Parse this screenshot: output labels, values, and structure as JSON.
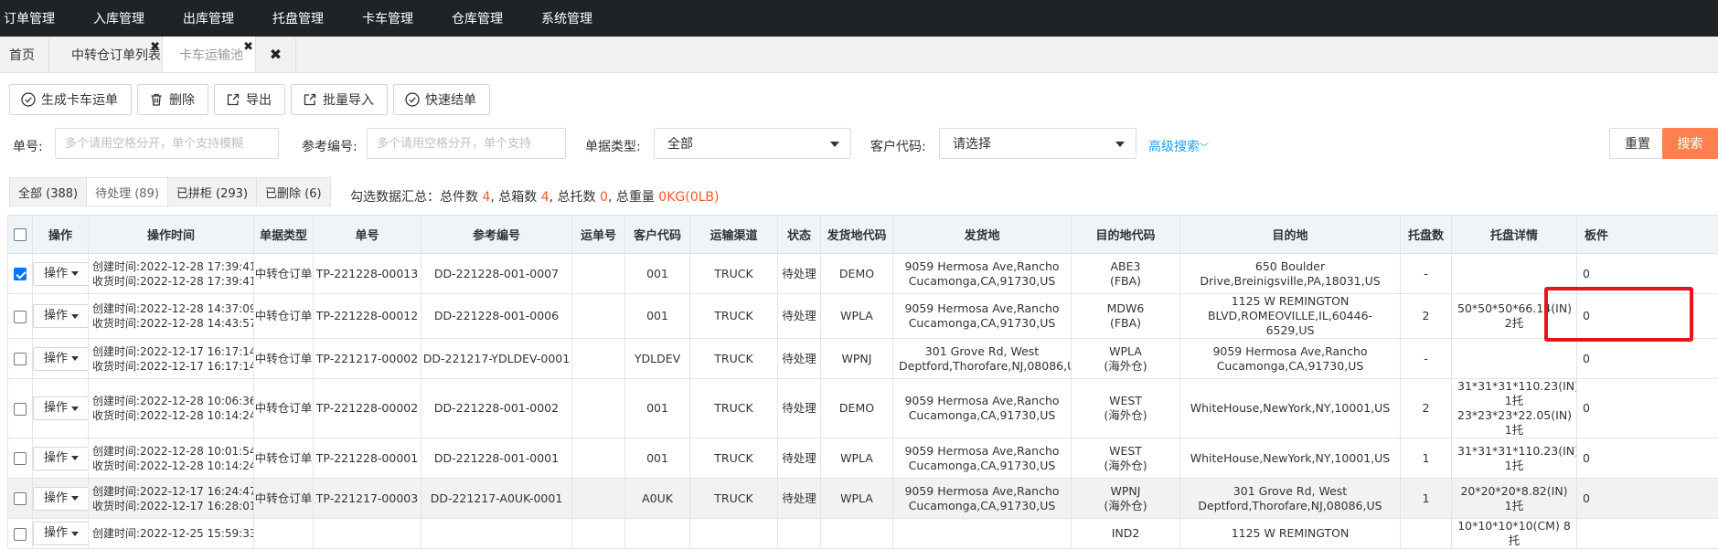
{
  "nav": [
    "订单管理",
    "入库管理",
    "出库管理",
    "托盘管理",
    "卡车管理",
    "仓库管理",
    "系统管理"
  ],
  "tabs": {
    "home": "首页",
    "t1": "中转仓订单列表",
    "t2": "卡车运输池"
  },
  "toolbar": {
    "generate": "生成卡车运单",
    "delete": "删除",
    "export": "导出",
    "import": "批量导入",
    "quick": "快速结单"
  },
  "filters": {
    "order_no_label": "单号:",
    "order_no_placeholder": "多个请用空格分开，单个支持模糊",
    "ref_label": "参考编号:",
    "ref_placeholder": "多个请用空格分开，单个支持",
    "type_label": "单据类型:",
    "type_value": "全部",
    "customer_label": "客户代码:",
    "customer_value": "请选择",
    "advanced": "高级搜索",
    "reset": "重置",
    "search": "搜索"
  },
  "status_tabs": [
    "全部 (388)",
    "待处理 (89)",
    "已拼柜 (293)",
    "已删除 (6)"
  ],
  "summary": {
    "prefix": "勾选数据汇总：总件数 ",
    "pieces": "4",
    "boxes_label": ", 总箱数 ",
    "boxes": "4",
    "pallets_label": ", 总托数 ",
    "pallets": "0",
    "weight_label": ", 总重量 ",
    "weight": "0KG(0LB)"
  },
  "columns": [
    "操作",
    "操作时间",
    "单据类型",
    "单号",
    "参考编号",
    "运单号",
    "客户代码",
    "运输渠道",
    "状态",
    "发货地代码",
    "发货地",
    "目的地代码",
    "目的地",
    "托盘数",
    "托盘详情",
    "板件"
  ],
  "op_label": "操作",
  "rows": [
    {
      "checked": true,
      "created": "创建时间:2022-12-28 17:39:41",
      "received": "收货时间:2022-12-28 17:39:41",
      "type": "中转仓订单",
      "no": "TP-221228-00013",
      "ref": "DD-221228-001-0007",
      "waybill": "",
      "customer": "001",
      "channel": "TRUCK",
      "status": "待处理",
      "from_code": "DEMO",
      "from": "9059 Hermosa Ave,Rancho Cucamonga,CA,91730,US",
      "to_code": "ABE3",
      "to_code2": "(FBA)",
      "to": "650 Boulder Drive,Breinigsville,PA,18031,US",
      "pallets": "-",
      "detail": "",
      "extra": "0"
    },
    {
      "checked": false,
      "created": "创建时间:2022-12-28 14:37:09",
      "received": "收货时间:2022-12-28 14:43:57",
      "type": "中转仓订单",
      "no": "TP-221228-00012",
      "ref": "DD-221228-001-0006",
      "waybill": "",
      "customer": "001",
      "channel": "TRUCK",
      "status": "待处理",
      "from_code": "WPLA",
      "from": "9059 Hermosa Ave,Rancho Cucamonga,CA,91730,US",
      "to_code": "MDW6",
      "to_code2": "(FBA)",
      "to": "1125 W REMINGTON BLVD,ROMEOVILLE,IL,60446-6529,US",
      "pallets": "2",
      "detail": "50*50*50*66.14(IN)  2托",
      "extra": "0"
    },
    {
      "checked": false,
      "created": "创建时间:2022-12-17 16:17:14",
      "received": "收货时间:2022-12-17 16:17:14",
      "type": "中转仓订单",
      "no": "TP-221217-00002",
      "ref": "DD-221217-YDLDEV-0001",
      "waybill": "",
      "customer": "YDLDEV",
      "channel": "TRUCK",
      "status": "待处理",
      "from_code": "WPNJ",
      "from": "301 Grove Rd, West Deptford,Thorofare,NJ,08086,US",
      "to_code": "WPLA",
      "to_code2": "(海外仓)",
      "to": "9059 Hermosa Ave,Rancho Cucamonga,CA,91730,US",
      "pallets": "-",
      "detail": "",
      "extra": "0"
    },
    {
      "checked": false,
      "created": "创建时间:2022-12-28 10:06:36",
      "received": "收货时间:2022-12-28 10:14:24",
      "type": "中转仓订单",
      "no": "TP-221228-00002",
      "ref": "DD-221228-001-0002",
      "waybill": "",
      "customer": "001",
      "channel": "TRUCK",
      "status": "待处理",
      "from_code": "DEMO",
      "from": "9059 Hermosa Ave,Rancho Cucamonga,CA,91730,US",
      "to_code": "WEST",
      "to_code2": "(海外仓)",
      "to": "WhiteHouse,NewYork,NY,10001,US",
      "pallets": "2",
      "detail": "31*31*31*110.23(IN)  1托 23*23*23*22.05(IN)  1托",
      "extra": "0"
    },
    {
      "checked": false,
      "created": "创建时间:2022-12-28 10:01:54",
      "received": "收货时间:2022-12-28 10:14:24",
      "type": "中转仓订单",
      "no": "TP-221228-00001",
      "ref": "DD-221228-001-0001",
      "waybill": "",
      "customer": "001",
      "channel": "TRUCK",
      "status": "待处理",
      "from_code": "WPLA",
      "from": "9059 Hermosa Ave,Rancho Cucamonga,CA,91730,US",
      "to_code": "WEST",
      "to_code2": "(海外仓)",
      "to": "WhiteHouse,NewYork,NY,10001,US",
      "pallets": "1",
      "detail": "31*31*31*110.23(IN)  1托",
      "extra": "0"
    },
    {
      "checked": false,
      "created": "创建时间:2022-12-17 16:24:47",
      "received": "收货时间:2022-12-17 16:28:01",
      "type": "中转仓订单",
      "no": "TP-221217-00003",
      "ref": "DD-221217-A0UK-0001",
      "waybill": "",
      "customer": "A0UK",
      "channel": "TRUCK",
      "status": "待处理",
      "from_code": "WPLA",
      "from": "9059 Hermosa Ave,Rancho Cucamonga,CA,91730,US",
      "to_code": "WPNJ",
      "to_code2": "(海外仓)",
      "to": "301 Grove Rd, West Deptford,Thorofare,NJ,08086,US",
      "pallets": "1",
      "detail": "20*20*20*8.82(IN)  1托",
      "extra": "0"
    },
    {
      "checked": false,
      "created": "创建时间:2022-12-25 15:59:33",
      "received": "",
      "type": "",
      "no": "",
      "ref": "",
      "waybill": "",
      "customer": "",
      "channel": "",
      "status": "",
      "from_code": "",
      "from": "",
      "to_code": "IND2",
      "to_code2": "",
      "to": "1125 W REMINGTON",
      "pallets": "",
      "detail": "10*10*10*10(CM)  8托",
      "extra": ""
    }
  ]
}
